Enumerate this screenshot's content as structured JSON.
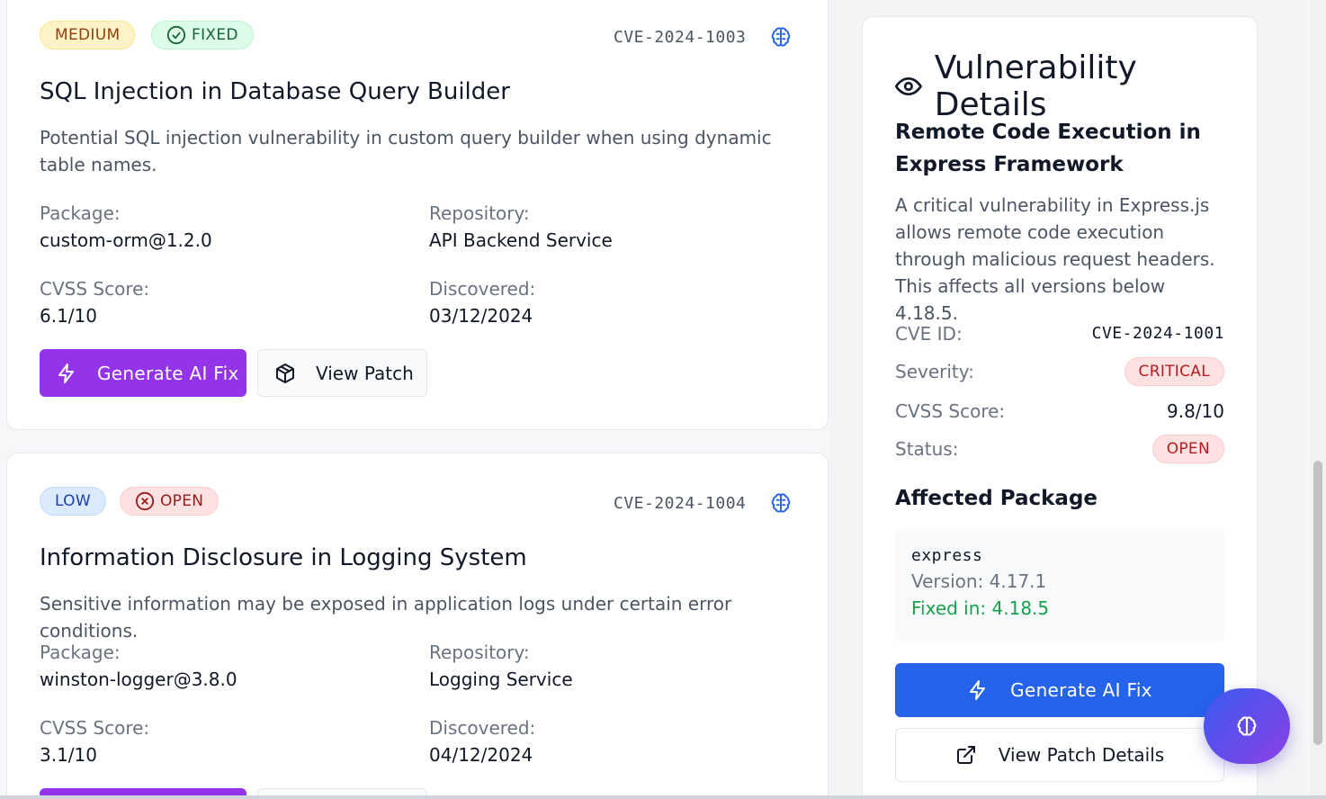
{
  "colors": {
    "accent_purple": "#9333ea",
    "accent_blue": "#2563eb",
    "critical_red": "#b91c1c",
    "fixed_green": "#16a34a"
  },
  "cards": [
    {
      "severity": "MEDIUM",
      "status": "FIXED",
      "status_icon": "check-circle-icon",
      "cve": "CVE-2024-1003",
      "title": "SQL Injection in Database Query Builder",
      "description": "Potential SQL injection vulnerability in custom query builder when using dynamic table names.",
      "package_label": "Package:",
      "package": "custom-orm@1.2.0",
      "repository_label": "Repository:",
      "repository": "API Backend Service",
      "cvss_label": "CVSS Score:",
      "cvss": "6.1/10",
      "discovered_label": "Discovered:",
      "discovered": "03/12/2024",
      "ai_fix_label": "Generate AI Fix",
      "view_patch_label": "View Patch"
    },
    {
      "severity": "LOW",
      "status": "OPEN",
      "status_icon": "x-circle-icon",
      "cve": "CVE-2024-1004",
      "title": "Information Disclosure in Logging System",
      "description": "Sensitive information may be exposed in application logs under certain error conditions.",
      "package_label": "Package:",
      "package": "winston-logger@3.8.0",
      "repository_label": "Repository:",
      "repository": "Logging Service",
      "cvss_label": "CVSS Score:",
      "cvss": "3.1/10",
      "discovered_label": "Discovered:",
      "discovered": "04/12/2024"
    }
  ],
  "details": {
    "heading": "Vulnerability Details",
    "title": "Remote Code Execution in Express Framework",
    "description": "A critical vulnerability in Express.js allows remote code execution through malicious request headers. This affects all versions below 4.18.5.",
    "cve_label": "CVE ID:",
    "cve": "CVE-2024-1001",
    "severity_label": "Severity:",
    "severity": "CRITICAL",
    "cvss_label": "CVSS Score:",
    "cvss": "9.8/10",
    "status_label": "Status:",
    "status": "OPEN",
    "affected_heading": "Affected Package",
    "package_name": "express",
    "version": "Version: 4.17.1",
    "fixed_in": "Fixed in: 4.18.5",
    "ai_fix_label": "Generate AI Fix",
    "patch_details_label": "View Patch Details"
  }
}
